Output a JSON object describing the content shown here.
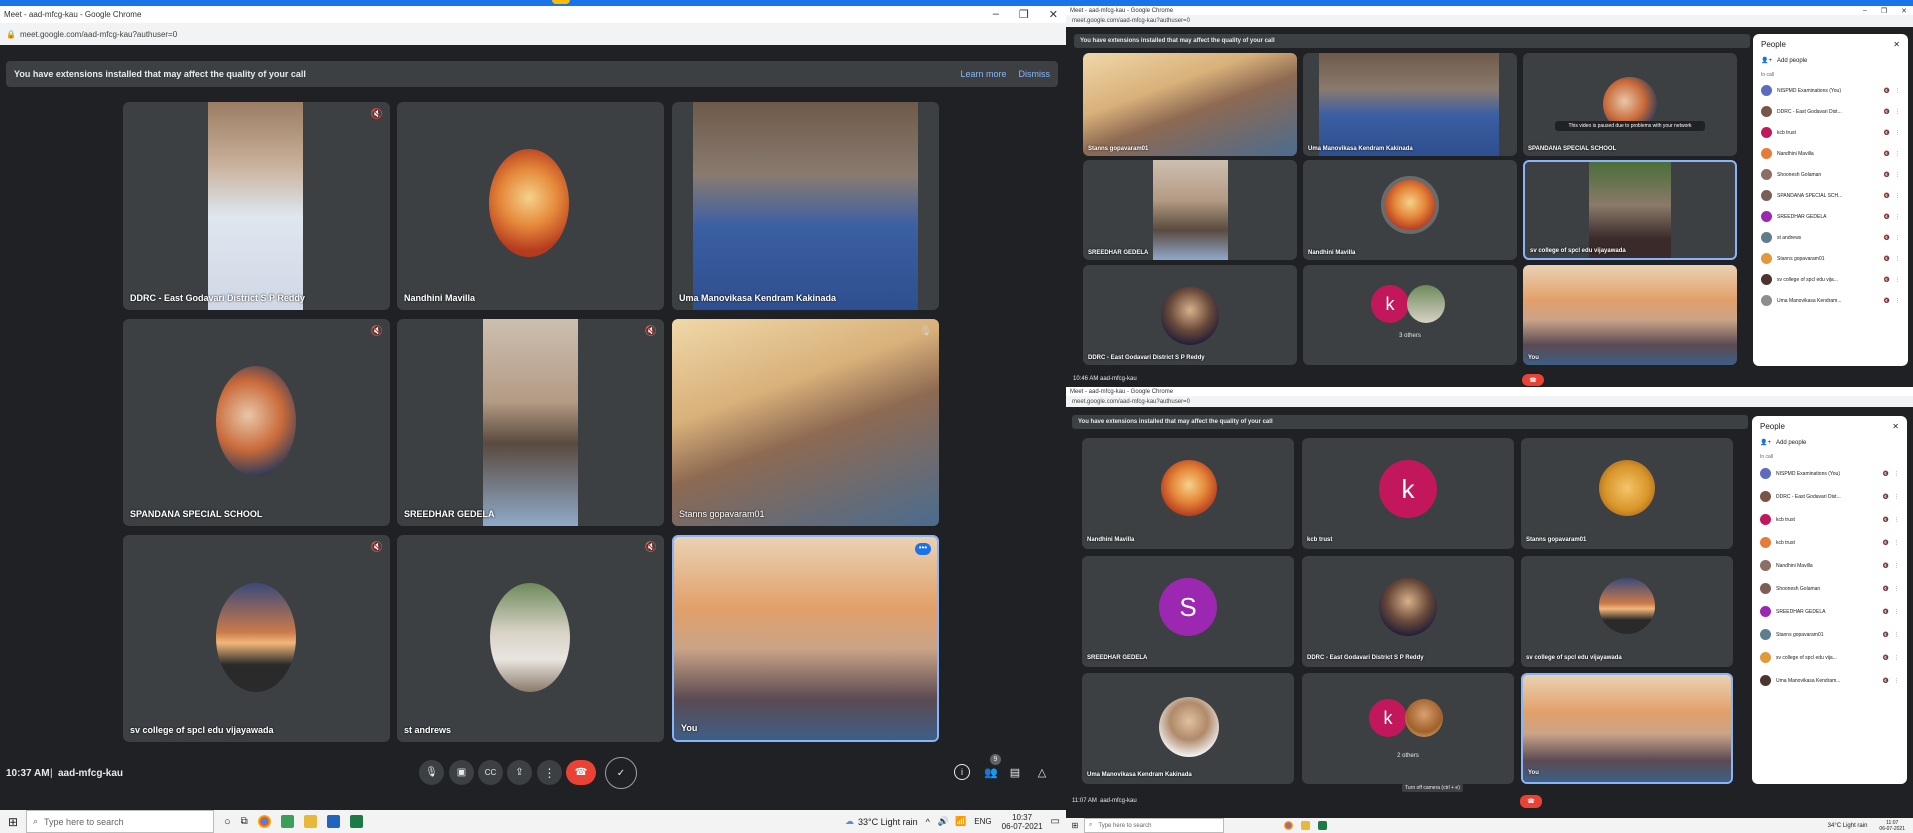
{
  "left": {
    "title": "Meet - aad-mfcg-kau - Google Chrome",
    "url": "meet.google.com/aad-mfcg-kau?authuser=0",
    "banner": {
      "text": "You have extensions installed that may affect the quality of your call",
      "learn": "Learn more",
      "dismiss": "Dismiss"
    },
    "tiles": [
      "DDRC - East Godavari District S P Reddy",
      "Nandhini Mavilla",
      "Uma Manovikasa Kendram Kakinada",
      "SPANDANA SPECIAL SCHOOL",
      "SREEDHAR GEDELA",
      "Stanns gopavaram01",
      "sv college of spcl edu vijayawada",
      "st andrews",
      "You"
    ],
    "time": "10:37 AM",
    "meeting": "aad-mfcg-kau"
  },
  "topright": {
    "title": "Meet - aad-mfcg-kau - Google Chrome",
    "url": "meet.google.com/aad-mfcg-kau?authuser=0",
    "banner": "You have extensions installed that may affect the quality of your call",
    "tiles": [
      "Stanns gopavaram01",
      "Uma Manovikasa Kendram Kakinada",
      "SPANDANA SPECIAL SCHOOL",
      "SREEDHAR GEDELA",
      "Nandhini Mavilla",
      "sv college of spcl edu vijayawada",
      "DDRC - East Godavari District S P Reddy",
      "3 others",
      "You"
    ],
    "paused": "This video is paused due to problems with your network",
    "kletter": "k",
    "time": "10:46 AM",
    "meeting": "aad-mfcg-kau",
    "people": {
      "title": "People",
      "add": "Add people",
      "section": "In call",
      "list": [
        "NISPMD Examinations (You)",
        "DDRC - East Godavari Dist...",
        "kcb trust",
        "Nandhini Mavilla",
        "Shoonesh Golaman",
        "SPANDANA SPECIAL SCH...",
        "SREEDHAR GEDELA",
        "st andrews",
        "Stanns gopavaram01",
        "sv college of spcl edu vija...",
        "Uma Manovikasa Kendram..."
      ]
    }
  },
  "bottomright": {
    "title": "Meet - aad-mfcg-kau - Google Chrome",
    "url": "meet.google.com/aad-mfcg-kau?authuser=0",
    "banner": "You have extensions installed that may affect the quality of your call",
    "tiles": [
      "Nandhini Mavilla",
      "kcb trust",
      "Stanns gopavaram01",
      "SREEDHAR GEDELA",
      "DDRC - East Godavari District S P Reddy",
      "sv college of spcl edu vijayawada",
      "Uma Manovikasa Kendram Kakinada",
      "2 others",
      "You"
    ],
    "kletter": "k",
    "sletter": "S",
    "tooltip": "Turn off camera (ctrl + e)",
    "time": "11:07 AM",
    "meeting": "aad-mfcg-kau",
    "people": {
      "title": "People",
      "add": "Add people",
      "section": "In call",
      "list": [
        "NISPMD Examinations (You)",
        "DDRC - East Godavari Dist...",
        "kcb trust",
        "kcb trust",
        "Nandhini Mavilla",
        "Shoonesh Golaman",
        "SREEDHAR GEDELA",
        "Stanns gopavaram01",
        "sv college of spcl edu vija...",
        "Uma Manovikasa Kendram..."
      ]
    }
  },
  "taskbar": {
    "search": "Type here to search",
    "weather": "33°C  Light rain",
    "lang": "ENG",
    "time": "10:37",
    "date": "06-07-2021"
  },
  "taskbar2": {
    "search": "Type here to search",
    "weather": "34°C  Light rain",
    "time": "11:07",
    "date": "06-07-2021"
  }
}
